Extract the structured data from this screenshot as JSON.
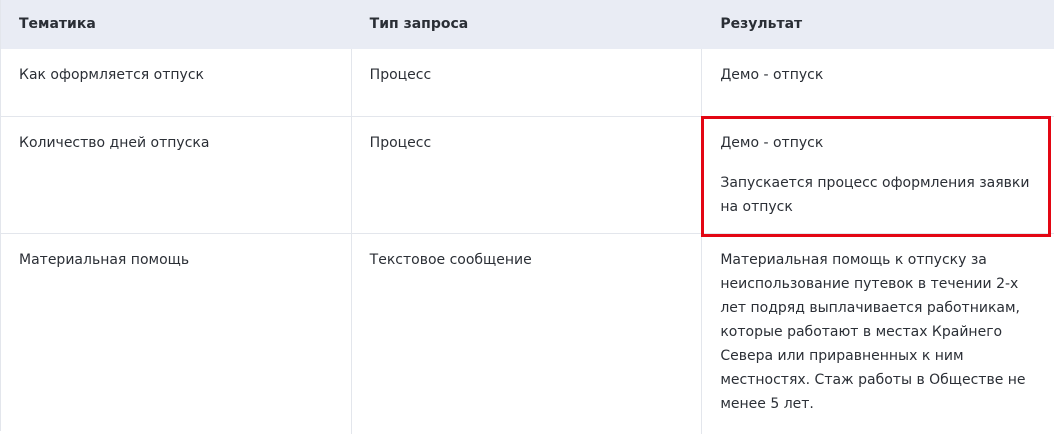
{
  "table": {
    "headers": [
      "Тематика",
      "Тип запроса",
      "Результат"
    ],
    "rows": [
      {
        "topic": "Как оформляется отпуск",
        "request_type": "Процесс",
        "result": [
          "Демо - отпуск"
        ]
      },
      {
        "topic": "Количество дней отпуска",
        "request_type": "Процесс",
        "result": [
          "Демо - отпуск",
          "Запускается процесс оформления заявки на отпуск"
        ]
      },
      {
        "topic": "Материальная помощь",
        "request_type": "Текстовое сообщение",
        "result": [
          "Материальная помощь к отпуску за неиспользование путевок в течении 2-х лет подряд выплачивается работникам, которые работают в местах Крайнего Севера или приравненных к ним местностях. Стаж работы в Обществе не менее 5 лет."
        ]
      }
    ]
  },
  "colors": {
    "header_bg": "#e9ecf4",
    "border": "#e3e6ec",
    "highlight": "#e30613"
  }
}
